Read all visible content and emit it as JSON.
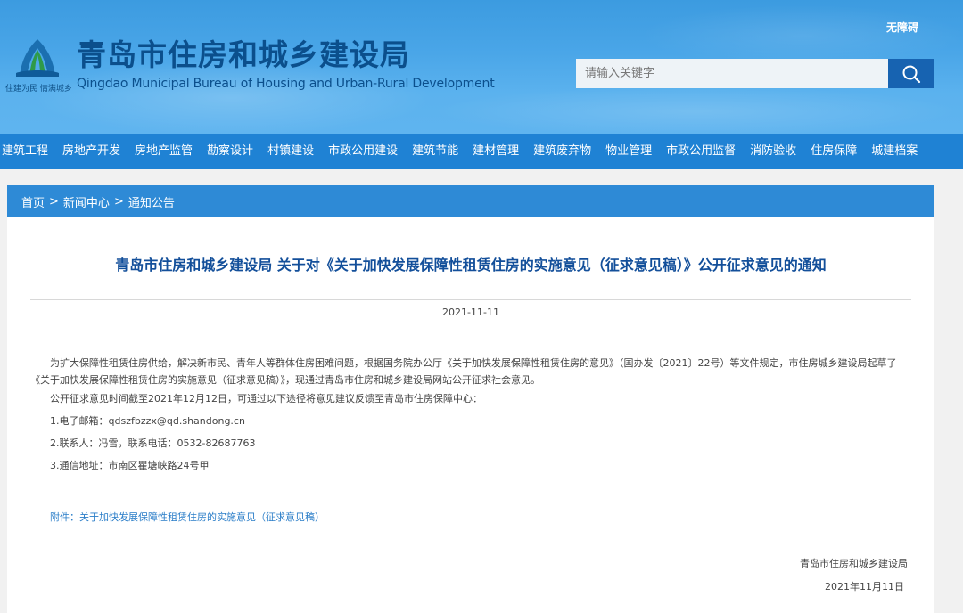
{
  "header": {
    "site_title": "青岛市住房和城乡建设局",
    "site_subtitle": "Qingdao Municipal Bureau of Housing and Urban-Rural Development",
    "slogan": "住建为民 情满城乡",
    "accessibility_label": "无障碍",
    "search_placeholder": "请输入关键字"
  },
  "nav": {
    "items": [
      "建筑工程",
      "房地产开发",
      "房地产监管",
      "勘察设计",
      "村镇建设",
      "市政公用建设",
      "建筑节能",
      "建材管理",
      "建筑废弃物",
      "物业管理",
      "市政公用监督",
      "消防验收",
      "住房保障",
      "城建档案"
    ]
  },
  "breadcrumb": {
    "home": "首页",
    "news": "新闻中心",
    "notice": "通知公告",
    "separator": ">"
  },
  "article": {
    "title": "青岛市住房和城乡建设局 关于对《关于加快发展保障性租赁住房的实施意见（征求意见稿）》公开征求意见的通知",
    "date": "2021-11-11",
    "para1": "为扩大保障性租赁住房供给，解决新市民、青年人等群体住房困难问题，根据国务院办公厅《关于加快发展保障性租赁住房的意见》（国办发〔2021〕22号）等文件规定，市住房城乡建设局起草了《关于加快发展保障性租赁住房的实施意见（征求意见稿）》，现通过青岛市住房和城乡建设局网站公开征求社会意见。",
    "para2": "公开征求意见时间截至2021年12月12日，可通过以下途径将意见建议反馈至青岛市住房保障中心：",
    "item1": "1.电子邮箱：qdszfbzzx@qd.shandong.cn",
    "item2": "2.联系人：冯雪，联系电话：0532-82687763",
    "item3": "3.通信地址：市南区瞿塘峡路24号甲",
    "attachment": "附件：关于加快发展保障性租赁住房的实施意见（征求意见稿）",
    "signature": "青岛市住房和城乡建设局",
    "sign_date": "2021年11月11日"
  },
  "colors": {
    "header_blue": "#4aa6e8",
    "nav_blue": "#1f82d4",
    "title_blue": "#134f9a",
    "search_button": "#1763b1"
  }
}
